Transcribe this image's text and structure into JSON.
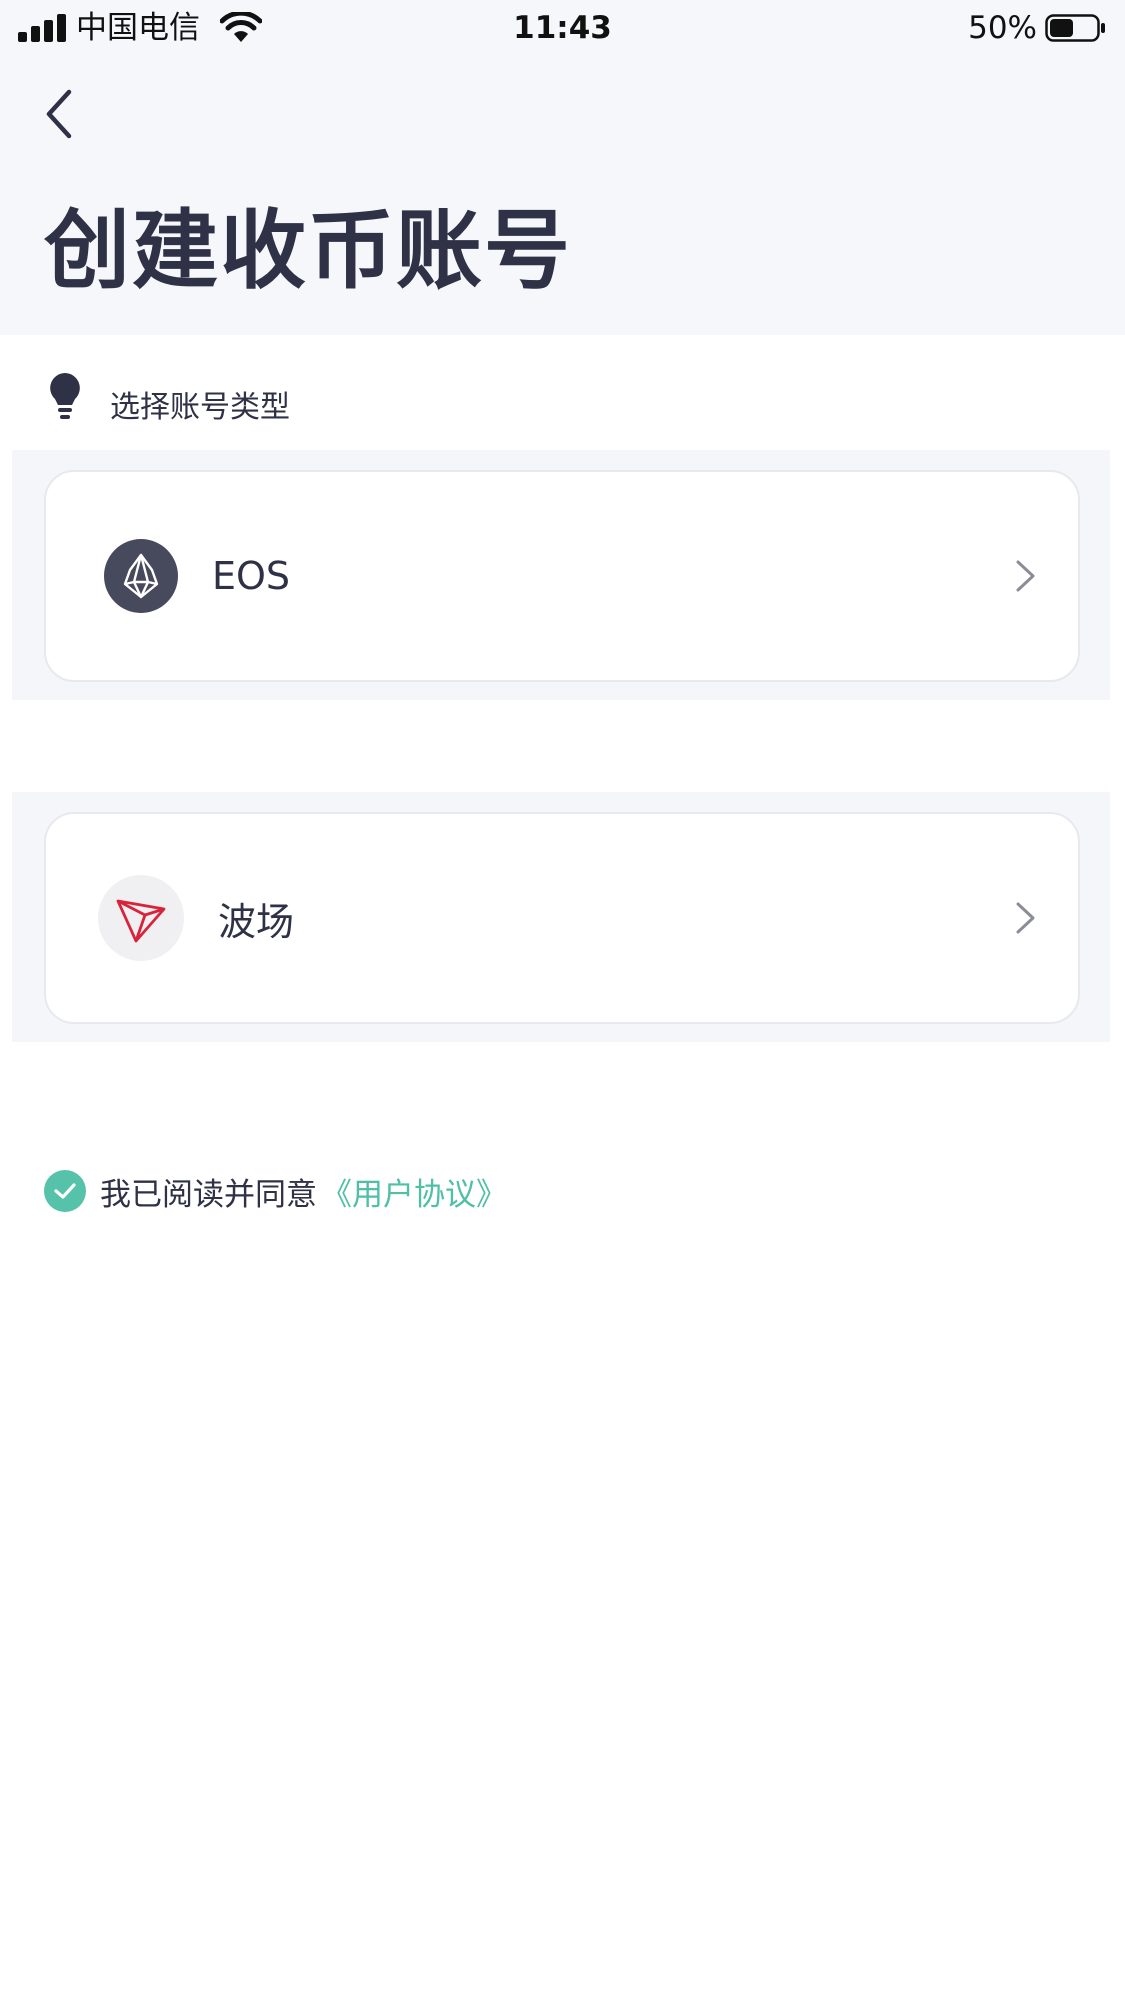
{
  "status_bar": {
    "carrier": "中国电信",
    "time": "11:43",
    "battery_percent": "50%",
    "battery_level": 0.5
  },
  "header": {
    "title": "创建收币账号"
  },
  "section": {
    "hint": "选择账号类型"
  },
  "account_types": [
    {
      "name": "EOS",
      "icon": "eos-icon"
    },
    {
      "name": "波场",
      "icon": "tron-icon"
    }
  ],
  "agreement": {
    "text": "我已阅读并同意",
    "link": "《用户协议》",
    "checked": true
  },
  "colors": {
    "accent": "#4fbfa6",
    "title": "#2f3146",
    "header_bg": "#f6f7fb",
    "tron_red": "#d8233a"
  }
}
